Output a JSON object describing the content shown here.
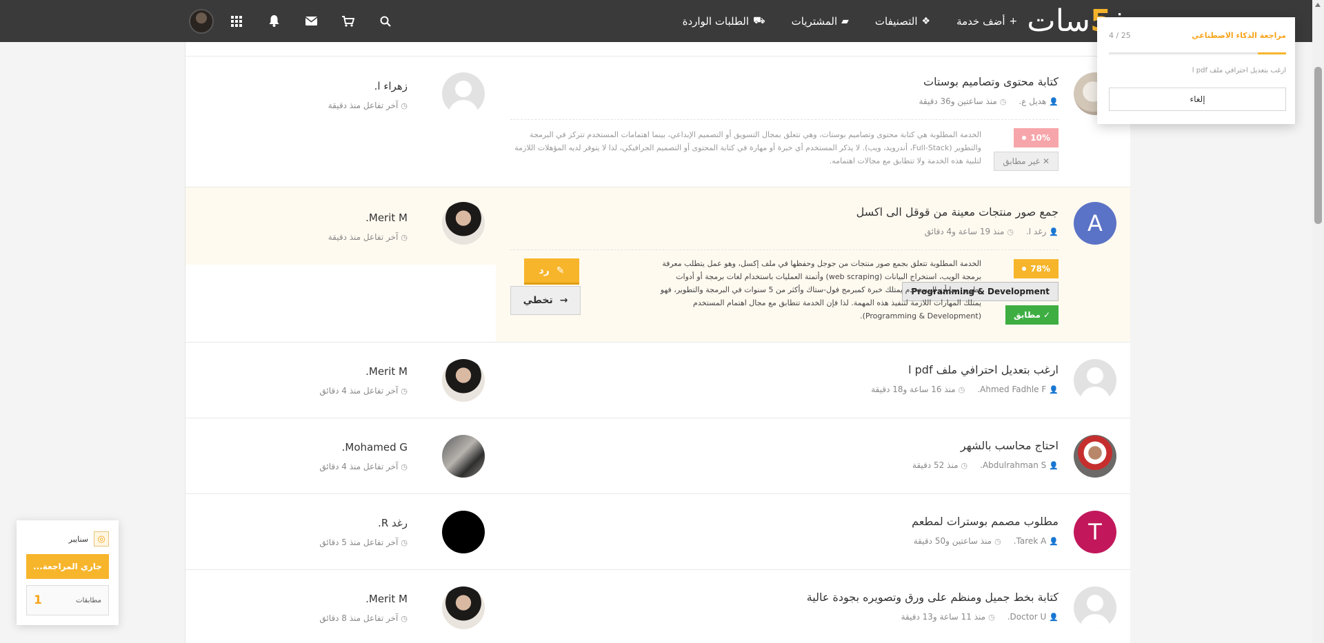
{
  "nav": {
    "logo_left": "خ",
    "logo_five": "5",
    "logo_right": "سات",
    "links": [
      {
        "label": "أضف خدمة",
        "icon": "plus-icon"
      },
      {
        "label": "التصنيفات",
        "icon": "cubes-icon"
      },
      {
        "label": "المشتريات",
        "icon": "folder-open-icon"
      },
      {
        "label": "الطلبات الواردة",
        "icon": "truck-icon"
      }
    ]
  },
  "rows": [
    {
      "title": "كتابة محتوى وتصاميم بوستات",
      "author": "هديل ع.",
      "time": "منذ ساعتين و36 دقيقة",
      "client_name": "زهراء ا.",
      "client_meta": "آخر تفاعل منذ دقيقة",
      "ai_percent": "10%",
      "ai_status": "غير مطابق",
      "ai_desc": [
        "الخدمة المطلوبة هي كتابة محتوى وتصاميم بوستات، وهي تتعلق بمجال التسويق أو التصميم الإبداعي، بينما اهتمامات المستخدم تتركز في البرمجة",
        "والتطوير (Full-Stack، أندرويد، ويب). لا يذكر المستخدم أي خبرة أو مهارة في كتابة المحتوى أو التصميم الجرافيكي، لذا لا يتوفر لديه المؤهلات اللازمة",
        "لتلبية هذه الخدمة ولا تتطابق مع مجالات اهتمامه."
      ]
    },
    {
      "title": "جمع صور منتجات معينة من قوقل الى اكسل",
      "avatar_letter": "A",
      "author": "رغد ا.",
      "time": "منذ 19 ساعة و4 دقائق",
      "client_name": "Merit M.",
      "client_meta": "آخر تفاعل منذ دقيقة",
      "ai_percent": "78%",
      "ai_category": "Programming & Development",
      "ai_status": "مطابق",
      "ai_desc": [
        "الخدمة المطلوبة تتعلق بجمع صور منتجات من جوجل وحفظها في ملف إكسل، وهو عمل يتطلب معرفة",
        "برمجة الويب، استخراج البيانات (web scraping) وأتمتة العمليات باستخدام لغات برمجة أو أدوات",
        "تطوير. بما أن المستخدم يمتلك خبرة كمبرمج فول-ستاك وأكثر من 5 سنوات في البرمجة والتطوير، فهو",
        "يمتلك المهارات اللازمة لتنفيذ هذه المهمة. لذا فإن الخدمة تتطابق مع مجال اهتمام المستخدم",
        "(Programming & Development)."
      ],
      "reply_label": "رد",
      "skip_label": "تخطي"
    },
    {
      "title": "ارغب بتعديل احترافي ملف pdf ا",
      "author": "Ahmed Fadhle F.",
      "time": "منذ 16 ساعة و18 دقيقة",
      "client_name": "Merit M.",
      "client_meta": "آخر تفاعل منذ 4 دقائق"
    },
    {
      "title": "احتاج محاسب بالشهر",
      "author": "Abdulrahman S.",
      "time": "منذ 52 دقيقة",
      "client_name": "Mohamed G.",
      "client_meta": "آخر تفاعل منذ 4 دقائق"
    },
    {
      "title": "مطلوب مصمم بوسترات لمطعم",
      "avatar_letter": "T",
      "author": "Tarek A.",
      "time": "منذ ساعتين و50 دقيقة",
      "client_name": "رغد R.",
      "client_meta": "آخر تفاعل منذ 5 دقائق"
    },
    {
      "title": "كتابة بخط جميل ومنظم على ورق وتصويره بجودة عالية",
      "author": "Doctor U.",
      "time": "منذ 11 ساعة و13 دقيقة",
      "client_name": "Merit M.",
      "client_meta": "آخر تفاعل منذ 8 دقائق"
    }
  ],
  "popover": {
    "title": "مراجعة الذكاء الاصطناعي",
    "count": "4 / 25",
    "progress_fraction": 0.16,
    "subtitle": "ارغب بتعديل احترافي ملف pdf ا",
    "cancel_label": "إلغاء"
  },
  "widget": {
    "title": "سنايبر",
    "status_button": "جاري المراجعة...",
    "matches_count": "1",
    "matches_label": "مطابقات"
  },
  "colors": {
    "accent": "#f7b52b",
    "navbar": "#3a3a3a",
    "match_green": "#3eae43",
    "nomatch_pink": "#f6a6aa"
  }
}
